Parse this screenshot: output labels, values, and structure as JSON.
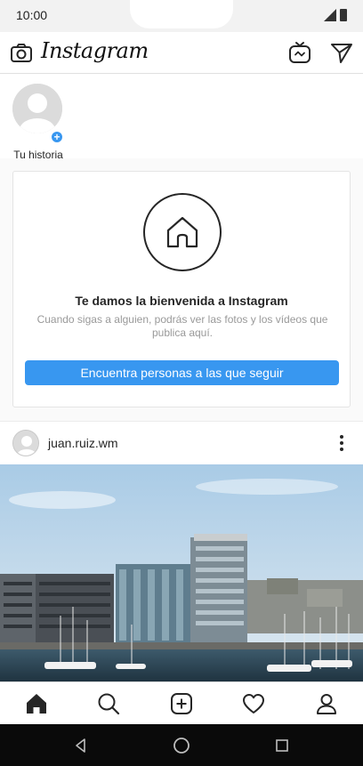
{
  "status_bar": {
    "time": "10:00"
  },
  "header": {
    "logo_text": "Instagram"
  },
  "stories": [
    {
      "label": "Tu historia",
      "add_glyph": "+"
    }
  ],
  "welcome": {
    "title": "Te damos la bienvenida a Instagram",
    "subtitle": "Cuando sigas a alguien, podrás ver las fotos y los vídeos que publica aquí.",
    "button_label": "Encuentra personas a las que seguir"
  },
  "post": {
    "username": "juan.ruiz.wm"
  },
  "bottom_nav": {
    "items": [
      {
        "icon": "home-icon",
        "active": true
      },
      {
        "icon": "search-icon",
        "active": false
      },
      {
        "icon": "new-post-icon",
        "active": false
      },
      {
        "icon": "heart-icon",
        "active": false
      },
      {
        "icon": "profile-icon",
        "active": false
      }
    ]
  },
  "system_nav": {
    "buttons": [
      "back",
      "home",
      "recents"
    ]
  },
  "colors": {
    "accent": "#3897f0",
    "text": "#262626",
    "muted": "#999999",
    "system_nav_bg": "#0a0a0a",
    "status_bar_bg": "#f2f2f2"
  }
}
